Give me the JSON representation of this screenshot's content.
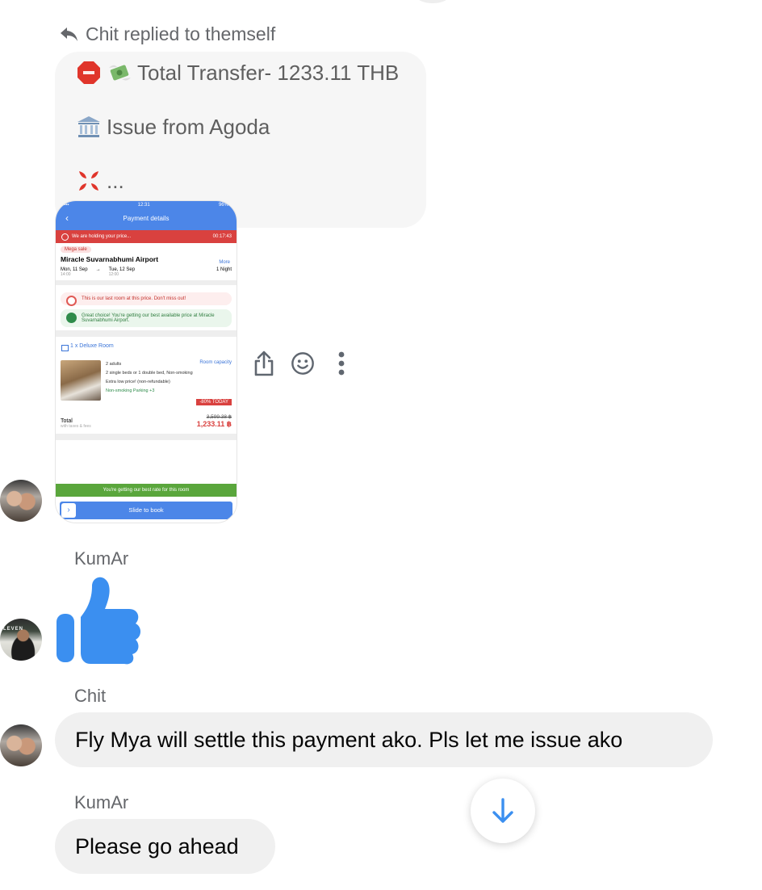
{
  "thread": {
    "reply_note": "Chit replied to themself",
    "quoted": {
      "line1_text": "Total Transfer- 1233.11 THB",
      "line2_text": "Issue from Agoda",
      "line3_text": "..."
    },
    "attachment": {
      "status_time": "12:31",
      "battery": "96%",
      "header_title": "Payment details",
      "holding_text": "We are holding your price...",
      "countdown": "00:17:43",
      "promo_pill": "Mega sale",
      "hotel_name": "Miracle Suvarnabhumi Airport",
      "more_label": "More",
      "checkin_day": "Mon, 11 Sep",
      "checkin_time": "14:00",
      "checkout_day": "Tue, 12 Sep",
      "checkout_time": "12:00",
      "nights": "1 Night",
      "alert_last_room": "This is our last room at this price. Don't miss out!",
      "alert_best_price": "Great choice! You're getting our best available price at Miracle Suvarnabhumi Airport.",
      "room_title": "1 x Deluxe Room",
      "room_capacity_label": "Room capacity",
      "feature_guests": "2 adults",
      "feature_beds": "2 single beds or 1 double bed, Non-smoking",
      "feature_price": "Extra low price! (non-refundable)",
      "tags": "Non-smoking  Parking  +3",
      "discount_badge": "-80% TODAY",
      "total_label": "Total",
      "total_sub": "with taxes & fees",
      "old_price": "3,599.38 ฿",
      "new_price": "1,233.11 ฿",
      "best_rate_text": "You're getting our best rate for this room",
      "slide_label": "Slide to book"
    }
  },
  "messages": [
    {
      "sender": "KumAr",
      "reaction": "thumbs-up"
    },
    {
      "sender": "Chit",
      "text": "Fly Mya will settle this payment ako. Pls let me issue ako"
    },
    {
      "sender": "KumAr",
      "text": "Please go ahead"
    }
  ],
  "icons": {
    "reply": "reply-arrow-icon",
    "share": "share-icon",
    "react": "smiley-icon",
    "more": "more-vertical-icon",
    "scroll_down": "arrow-down-icon",
    "stop_sign": "stop-sign-emoji",
    "money": "money-with-wings-emoji",
    "bank": "bank-emoji",
    "anger": "anger-emoji"
  },
  "colors": {
    "accent": "#3b8ff0",
    "bubble": "#f0f0f0",
    "secondary_text": "#65676b"
  },
  "avatar_sign": "LEVEN"
}
